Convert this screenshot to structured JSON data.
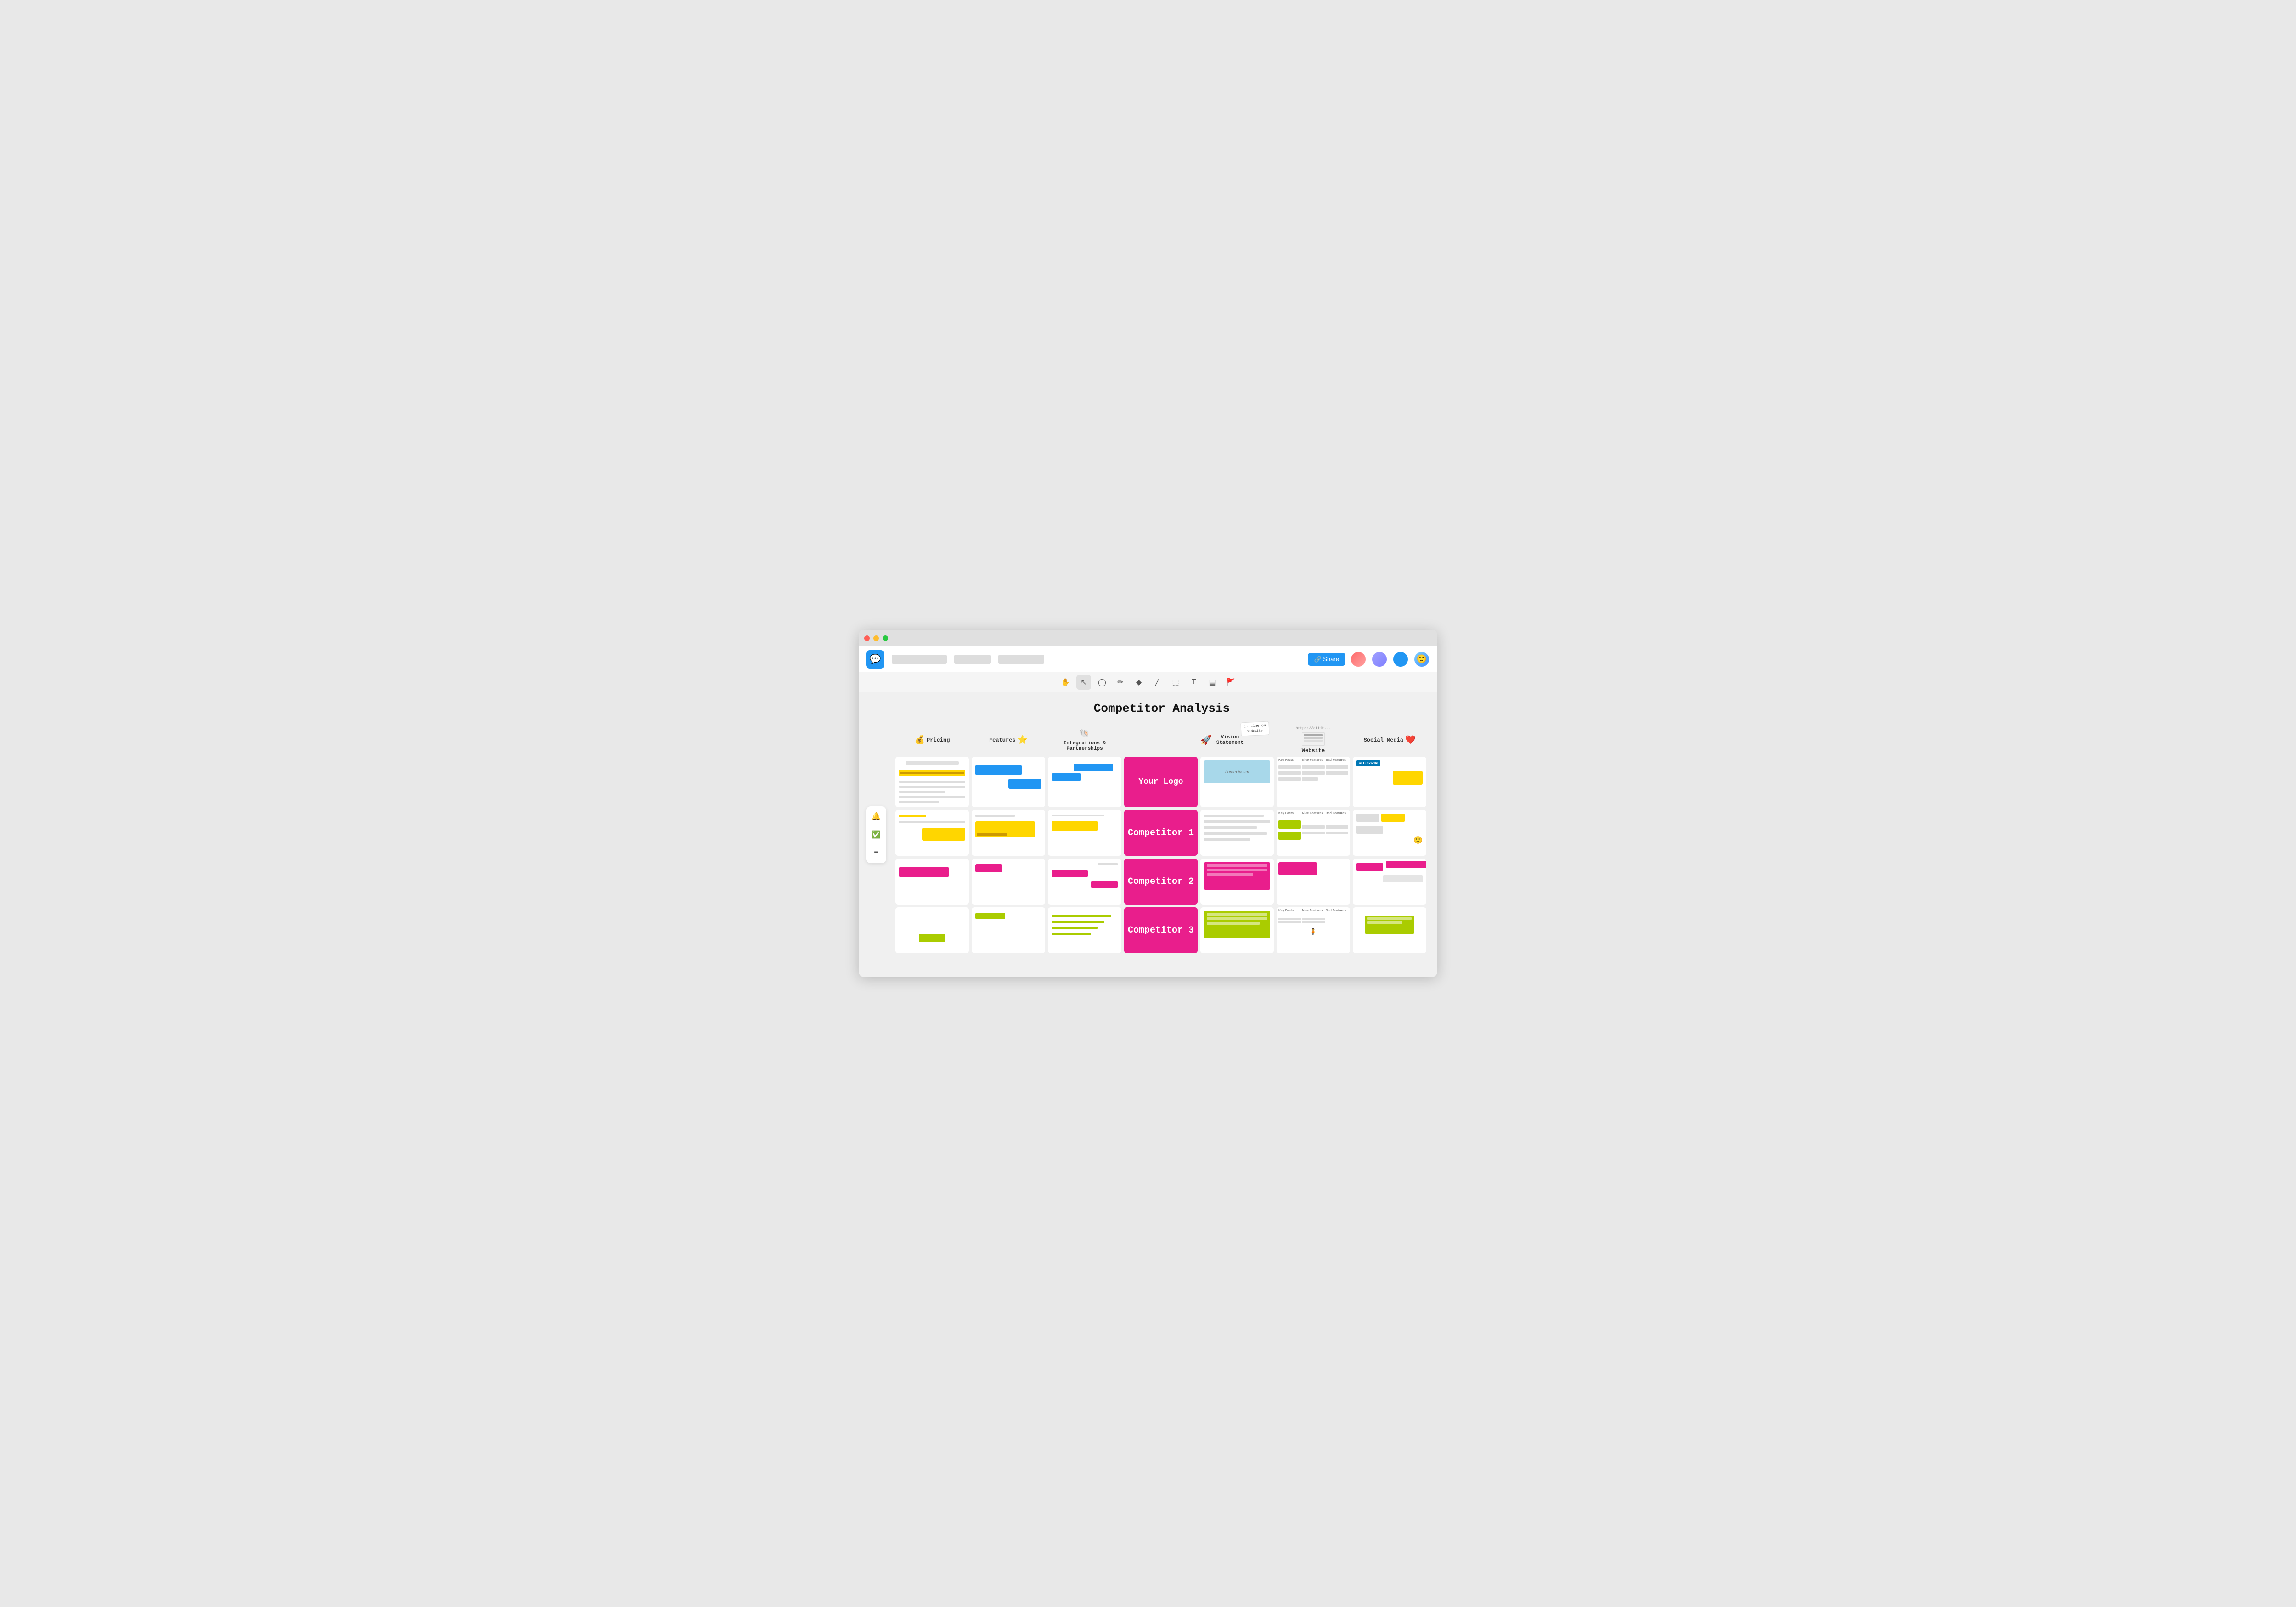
{
  "browser": {
    "traffic_lights": [
      "red",
      "yellow",
      "green"
    ]
  },
  "header": {
    "logo_icon": "💬",
    "nav_items": [
      "nav-item-1",
      "nav-item-2",
      "nav-item-3"
    ],
    "share_label": "🔗 Share"
  },
  "toolbar": {
    "tools": [
      "✋",
      "↖",
      "◯",
      "✏",
      "◆",
      "╱",
      "⬚",
      "T",
      "▤",
      "🚩"
    ]
  },
  "page": {
    "title": "Competitor Analysis"
  },
  "columns": {
    "headers": [
      "Pricing",
      "Features",
      "Integrations & Partnerships",
      "Your Logo",
      "Vision Statement",
      "Website",
      "Social Media"
    ]
  },
  "rows": {
    "labels": [
      "Your Logo",
      "Competitor 1",
      "Competitor 2",
      "Competitor 3"
    ]
  },
  "sidebar_tools": [
    "🔔",
    "✅",
    "≡"
  ]
}
